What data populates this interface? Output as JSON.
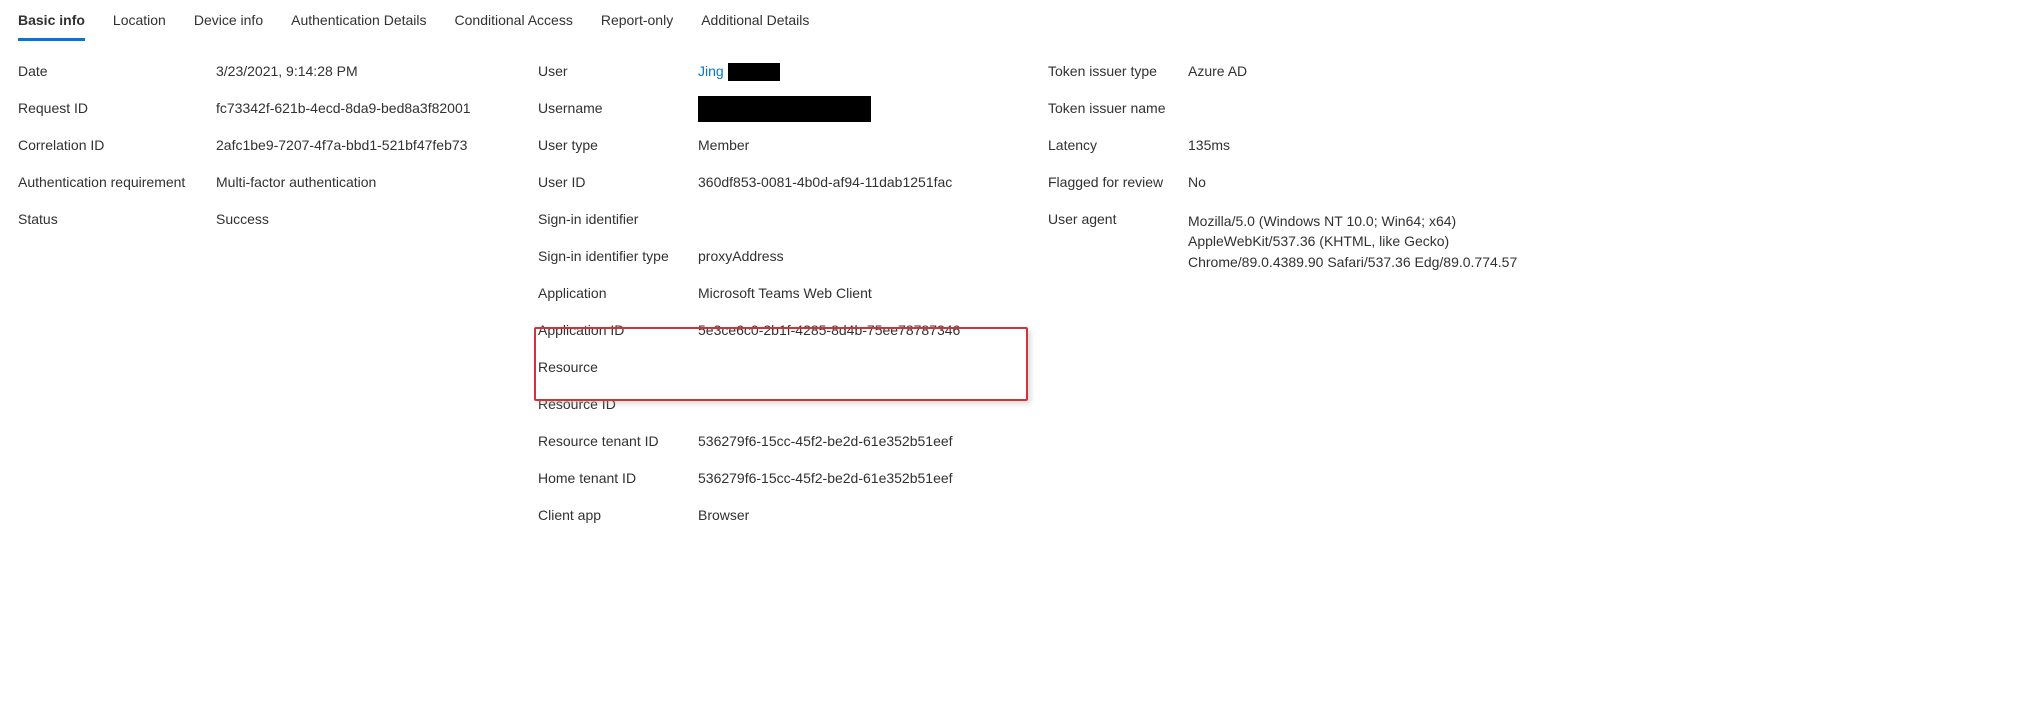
{
  "tabs": {
    "basic_info": "Basic info",
    "location": "Location",
    "device_info": "Device info",
    "auth_details": "Authentication Details",
    "cond_access": "Conditional Access",
    "report_only": "Report-only",
    "additional": "Additional Details"
  },
  "col1": {
    "date_l": "Date",
    "date_v": "3/23/2021, 9:14:28 PM",
    "reqid_l": "Request ID",
    "reqid_v": "fc73342f-621b-4ecd-8da9-bed8a3f82001",
    "corrid_l": "Correlation ID",
    "corrid_v": "2afc1be9-7207-4f7a-bbd1-521bf47feb73",
    "authreq_l": "Authentication requirement",
    "authreq_v": "Multi-factor authentication",
    "status_l": "Status",
    "status_v": "Success"
  },
  "col2": {
    "user_l": "User",
    "user_v": "Jing",
    "uname_l": "Username",
    "uname_v": "",
    "utype_l": "User type",
    "utype_v": "Member",
    "uid_l": "User ID",
    "uid_v": "360df853-0081-4b0d-af94-11dab1251fac",
    "sid_l": "Sign-in identifier",
    "sid_v": "",
    "sidt_l": "Sign-in identifier type",
    "sidt_v": "proxyAddress",
    "app_l": "Application",
    "app_v": "Microsoft Teams Web Client",
    "appid_l": "Application ID",
    "appid_v": "5e3ce6c0-2b1f-4285-8d4b-75ee78787346",
    "res_l": "Resource",
    "res_v": "",
    "resid_l": "Resource ID",
    "resid_v": "",
    "rtid_l": "Resource tenant ID",
    "rtid_v": "536279f6-15cc-45f2-be2d-61e352b51eef",
    "htid_l": "Home tenant ID",
    "htid_v": "536279f6-15cc-45f2-be2d-61e352b51eef",
    "capp_l": "Client app",
    "capp_v": "Browser"
  },
  "col3": {
    "tit_l": "Token issuer type",
    "tit_v": "Azure AD",
    "tin_l": "Token issuer name",
    "tin_v": "",
    "lat_l": "Latency",
    "lat_v": "135ms",
    "ffr_l": "Flagged for review",
    "ffr_v": "No",
    "ua_l": "User agent",
    "ua_v": "Mozilla/5.0 (Windows NT 10.0; Win64; x64) AppleWebKit/537.36 (KHTML, like Gecko) Chrome/89.0.4389.90 Safari/537.36 Edg/89.0.774.57"
  }
}
